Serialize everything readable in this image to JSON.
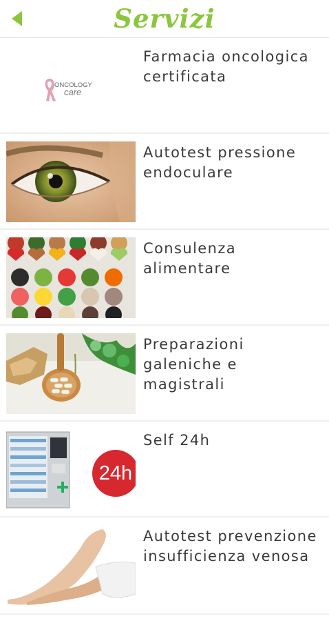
{
  "header": {
    "title": "Servizi",
    "accent_color": "#8cc63f",
    "back_icon": "back-arrow-icon"
  },
  "services": [
    {
      "label": "Farmacia oncologica certificata",
      "image": "oncology-care-logo",
      "logo_top": "ONCOLOGY",
      "logo_bottom": "care"
    },
    {
      "label": "Autotest pressione endoculare",
      "image": "eye-photo"
    },
    {
      "label": "Consulenza alimentare",
      "image": "food-bowls-photo"
    },
    {
      "label": "Preparazioni galeniche e magistrali",
      "image": "herbs-capsules-photo"
    },
    {
      "label": "Self 24h",
      "image": "vending-machine-photo",
      "badge": "24h",
      "badge_color": "#d7282f"
    },
    {
      "label": "Autotest prevenzione insufficienza venosa",
      "image": "legs-photo"
    }
  ]
}
